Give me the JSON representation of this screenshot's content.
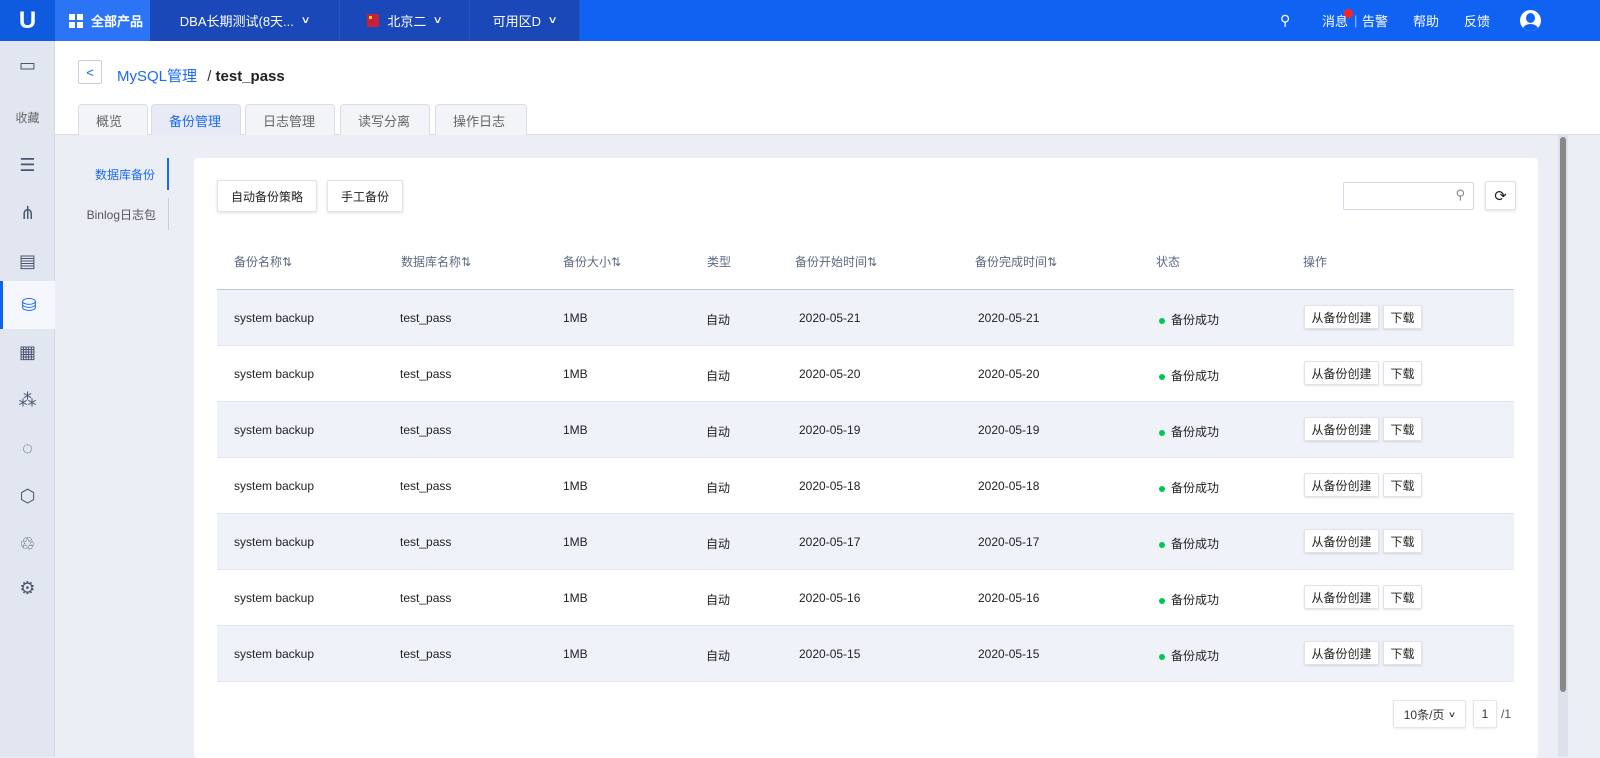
{
  "topbar": {
    "logo": "U",
    "all_products": "全部产品",
    "project": "DBA长期测试(8天...",
    "region": "北京二",
    "zone": "可用区D",
    "messages": "消息",
    "alerts": "告警",
    "help": "帮助",
    "feedback": "反馈",
    "accent": "#1062f2"
  },
  "sidebar": {
    "favorites": "收藏",
    "icons": [
      "monitor-icon",
      "servers-icon",
      "network-icon",
      "document-icon",
      "database-icon",
      "apps-icon",
      "cluster-icon",
      "monitoring-icon",
      "hexagon-icon",
      "recycle-icon",
      "settings-icon"
    ]
  },
  "breadcrumb": {
    "parent": "MySQL管理",
    "separator": "/",
    "current": "test_pass"
  },
  "tabs": [
    "概览",
    "备份管理",
    "日志管理",
    "读写分离",
    "操作日志"
  ],
  "subnav": [
    "数据库备份",
    "Binlog日志包"
  ],
  "toolbar": {
    "auto_policy": "自动备份策略",
    "manual_backup": "手工备份",
    "search_placeholder": ""
  },
  "table": {
    "headers": [
      "备份名称⇅",
      "数据库名称⇅",
      "备份大小⇅",
      "类型",
      "备份开始时间⇅",
      "备份完成时间⇅",
      "状态",
      "操作"
    ],
    "rows": [
      {
        "name": "system backup",
        "db": "test_pass",
        "size": "1MB",
        "type": "自动",
        "start": "2020-05-21",
        "end": "2020-05-21",
        "status": "备份成功"
      },
      {
        "name": "system backup",
        "db": "test_pass",
        "size": "1MB",
        "type": "自动",
        "start": "2020-05-20",
        "end": "2020-05-20",
        "status": "备份成功"
      },
      {
        "name": "system backup",
        "db": "test_pass",
        "size": "1MB",
        "type": "自动",
        "start": "2020-05-19",
        "end": "2020-05-19",
        "status": "备份成功"
      },
      {
        "name": "system backup",
        "db": "test_pass",
        "size": "1MB",
        "type": "自动",
        "start": "2020-05-18",
        "end": "2020-05-18",
        "status": "备份成功"
      },
      {
        "name": "system backup",
        "db": "test_pass",
        "size": "1MB",
        "type": "自动",
        "start": "2020-05-17",
        "end": "2020-05-17",
        "status": "备份成功"
      },
      {
        "name": "system backup",
        "db": "test_pass",
        "size": "1MB",
        "type": "自动",
        "start": "2020-05-16",
        "end": "2020-05-16",
        "status": "备份成功"
      },
      {
        "name": "system backup",
        "db": "test_pass",
        "size": "1MB",
        "type": "自动",
        "start": "2020-05-15",
        "end": "2020-05-15",
        "status": "备份成功"
      }
    ],
    "actions": {
      "create": "从备份创建",
      "download": "下载"
    },
    "status_color": "#00c853"
  },
  "pagination": {
    "page_size": "10条/页",
    "page": "1",
    "total": "/1"
  }
}
